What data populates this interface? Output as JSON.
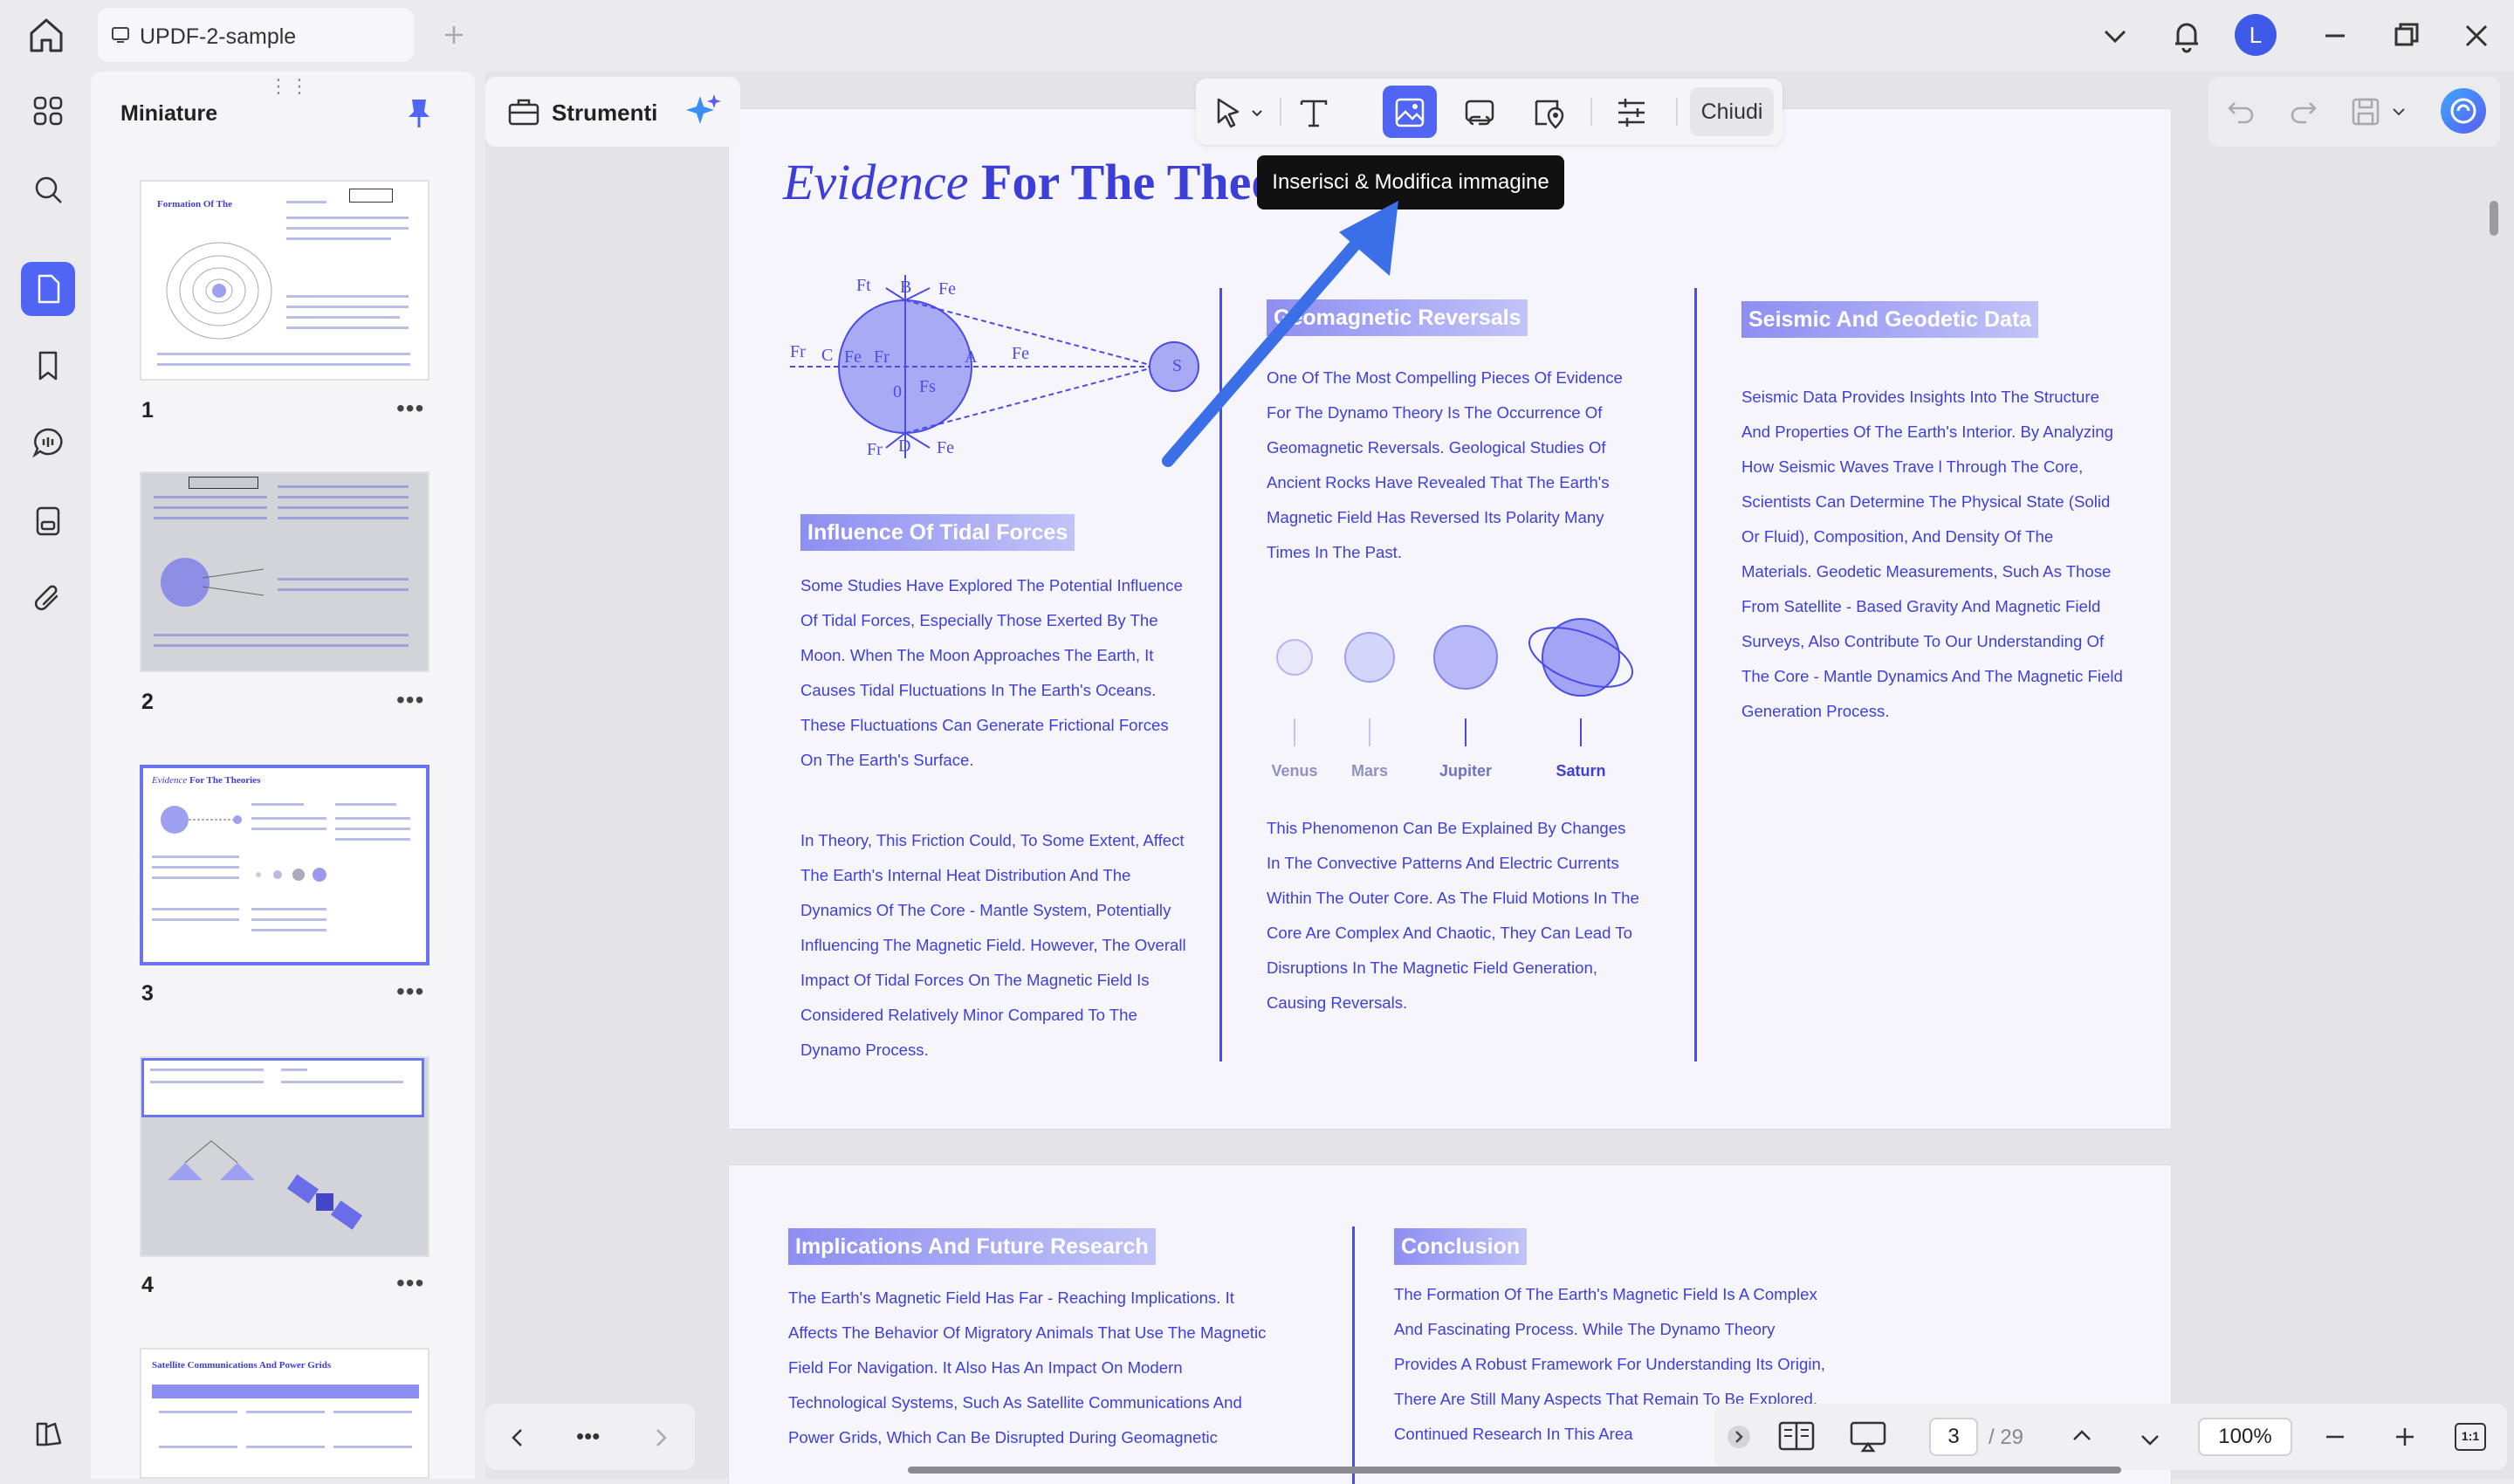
{
  "titlebar": {
    "tab_title": "UPDF-2-sample"
  },
  "avatar_letter": "L",
  "thumbnails": {
    "title": "Miniature",
    "pages": [
      "1",
      "2",
      "3",
      "4"
    ],
    "more": "•••",
    "page5_title": "Satellite Communications And Power Grids"
  },
  "toolbar": {
    "tools_label": "Strumenti",
    "close_label": "Chiudi",
    "tooltip": "Inserisci & Modifica immagine"
  },
  "page3": {
    "title_italic": "Evidence",
    "title_bold": "For The Theories",
    "diagram_labels": {
      "fr1": "Fr",
      "c": "C",
      "fe": "Fe",
      "b": "B",
      "ft": "Ft",
      "fr2": "Fr",
      "a": "A",
      "fe2": "Fe",
      "o": "0",
      "fs": "Fs",
      "d": "D",
      "s": "S"
    },
    "tidal_head": "Influence Of Tidal Forces",
    "tidal_p1": "Some Studies Have Explored The Potential Influence Of Tidal Forces, Especially Those Exerted By The Moon. When The Moon Approaches The Earth, It Causes Tidal Fluctuations In The Earth's Oceans. These Fluctuations Can Generate Frictional Forces On The Earth's Surface.",
    "tidal_p2": "In Theory, This Friction Could, To Some Extent, Affect The Earth's Internal Heat Distribution And The Dynamics Of The Core - Mantle System, Potentially Influencing The Magnetic Field. However, The Overall Impact Of Tidal Forces On The Magnetic Field Is Considered Relatively Minor Compared To The Dynamo Process.",
    "geo_head": "Geomagnetic Reversals",
    "geo_p1": "One Of The Most Compelling Pieces Of Evidence For The Dynamo Theory Is The Occurrence Of Geomagnetic Reversals. Geological Studies Of Ancient Rocks Have Revealed That The Earth's Magnetic Field Has Reversed Its Polarity Many Times In The Past.",
    "planets": [
      "Venus",
      "Mars",
      "Jupiter",
      "Saturn"
    ],
    "geo_p2": "This Phenomenon Can Be Explained By Changes In The Convective Patterns And Electric Currents Within The Outer Core. As The Fluid Motions In The Core Are Complex And Chaotic, They Can Lead To Disruptions In The Magnetic Field Generation, Causing Reversals.",
    "seismic_head": "Seismic And Geodetic Data",
    "seismic_p": "Seismic Data Provides Insights Into The Structure And Properties Of The Earth's Interior. By Analyzing How Seismic Waves Trave l Through The Core, Scientists Can Determine The Physical State (Solid Or Fluid), Composition, And Density Of The Materials. Geodetic Measurements, Such As Those From Satellite - Based Gravity And Magnetic Field Surveys, Also Contribute To Our Understanding Of The Core - Mantle Dynamics And The Magnetic Field Generation Process."
  },
  "page4": {
    "impl_head": "Implications And Future Research",
    "impl_p": "The Earth's Magnetic Field Has Far - Reaching Implications. It Affects The Behavior Of Migratory Animals That Use The Magnetic Field For Navigation. It Also Has An Impact On Modern Technological Systems, Such As Satellite Communications And Power Grids, Which Can Be Disrupted During Geomagnetic",
    "concl_head": "Conclusion",
    "concl_p": "The Formation Of The Earth's Magnetic Field Is A Complex And Fascinating Process. While The Dynamo Theory Provides A Robust Framework For Understanding Its Origin, There Are Still Many Aspects That Remain To Be Explored. Continued Research In This Area"
  },
  "bottom": {
    "nav_more": "•••",
    "current_page": "3",
    "total_pages": "/ 29",
    "zoom": "100%",
    "fit_label": "1:1"
  }
}
